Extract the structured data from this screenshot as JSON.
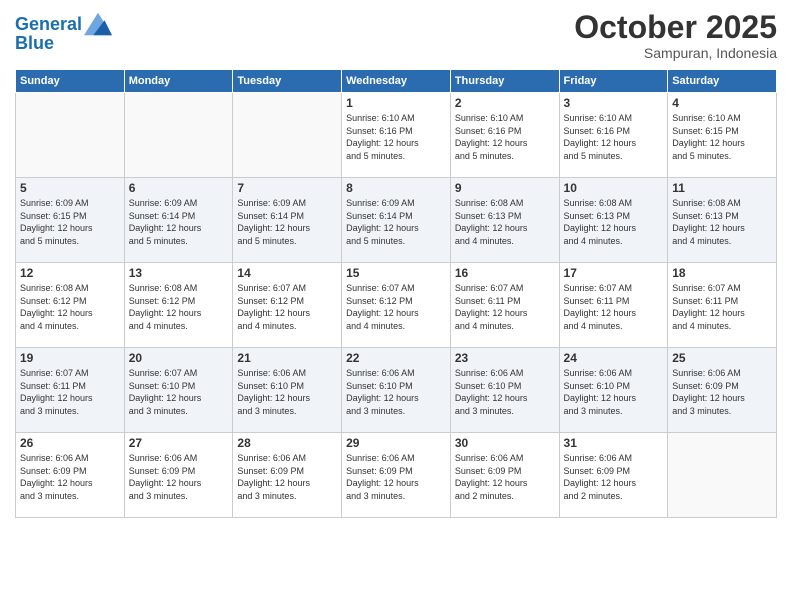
{
  "logo": {
    "line1": "General",
    "line2": "Blue"
  },
  "header": {
    "month": "October 2025",
    "location": "Sampuran, Indonesia"
  },
  "days_of_week": [
    "Sunday",
    "Monday",
    "Tuesday",
    "Wednesday",
    "Thursday",
    "Friday",
    "Saturday"
  ],
  "weeks": [
    [
      {
        "day": "",
        "info": ""
      },
      {
        "day": "",
        "info": ""
      },
      {
        "day": "",
        "info": ""
      },
      {
        "day": "1",
        "info": "Sunrise: 6:10 AM\nSunset: 6:16 PM\nDaylight: 12 hours\nand 5 minutes."
      },
      {
        "day": "2",
        "info": "Sunrise: 6:10 AM\nSunset: 6:16 PM\nDaylight: 12 hours\nand 5 minutes."
      },
      {
        "day": "3",
        "info": "Sunrise: 6:10 AM\nSunset: 6:16 PM\nDaylight: 12 hours\nand 5 minutes."
      },
      {
        "day": "4",
        "info": "Sunrise: 6:10 AM\nSunset: 6:15 PM\nDaylight: 12 hours\nand 5 minutes."
      }
    ],
    [
      {
        "day": "5",
        "info": "Sunrise: 6:09 AM\nSunset: 6:15 PM\nDaylight: 12 hours\nand 5 minutes."
      },
      {
        "day": "6",
        "info": "Sunrise: 6:09 AM\nSunset: 6:14 PM\nDaylight: 12 hours\nand 5 minutes."
      },
      {
        "day": "7",
        "info": "Sunrise: 6:09 AM\nSunset: 6:14 PM\nDaylight: 12 hours\nand 5 minutes."
      },
      {
        "day": "8",
        "info": "Sunrise: 6:09 AM\nSunset: 6:14 PM\nDaylight: 12 hours\nand 5 minutes."
      },
      {
        "day": "9",
        "info": "Sunrise: 6:08 AM\nSunset: 6:13 PM\nDaylight: 12 hours\nand 4 minutes."
      },
      {
        "day": "10",
        "info": "Sunrise: 6:08 AM\nSunset: 6:13 PM\nDaylight: 12 hours\nand 4 minutes."
      },
      {
        "day": "11",
        "info": "Sunrise: 6:08 AM\nSunset: 6:13 PM\nDaylight: 12 hours\nand 4 minutes."
      }
    ],
    [
      {
        "day": "12",
        "info": "Sunrise: 6:08 AM\nSunset: 6:12 PM\nDaylight: 12 hours\nand 4 minutes."
      },
      {
        "day": "13",
        "info": "Sunrise: 6:08 AM\nSunset: 6:12 PM\nDaylight: 12 hours\nand 4 minutes."
      },
      {
        "day": "14",
        "info": "Sunrise: 6:07 AM\nSunset: 6:12 PM\nDaylight: 12 hours\nand 4 minutes."
      },
      {
        "day": "15",
        "info": "Sunrise: 6:07 AM\nSunset: 6:12 PM\nDaylight: 12 hours\nand 4 minutes."
      },
      {
        "day": "16",
        "info": "Sunrise: 6:07 AM\nSunset: 6:11 PM\nDaylight: 12 hours\nand 4 minutes."
      },
      {
        "day": "17",
        "info": "Sunrise: 6:07 AM\nSunset: 6:11 PM\nDaylight: 12 hours\nand 4 minutes."
      },
      {
        "day": "18",
        "info": "Sunrise: 6:07 AM\nSunset: 6:11 PM\nDaylight: 12 hours\nand 4 minutes."
      }
    ],
    [
      {
        "day": "19",
        "info": "Sunrise: 6:07 AM\nSunset: 6:11 PM\nDaylight: 12 hours\nand 3 minutes."
      },
      {
        "day": "20",
        "info": "Sunrise: 6:07 AM\nSunset: 6:10 PM\nDaylight: 12 hours\nand 3 minutes."
      },
      {
        "day": "21",
        "info": "Sunrise: 6:06 AM\nSunset: 6:10 PM\nDaylight: 12 hours\nand 3 minutes."
      },
      {
        "day": "22",
        "info": "Sunrise: 6:06 AM\nSunset: 6:10 PM\nDaylight: 12 hours\nand 3 minutes."
      },
      {
        "day": "23",
        "info": "Sunrise: 6:06 AM\nSunset: 6:10 PM\nDaylight: 12 hours\nand 3 minutes."
      },
      {
        "day": "24",
        "info": "Sunrise: 6:06 AM\nSunset: 6:10 PM\nDaylight: 12 hours\nand 3 minutes."
      },
      {
        "day": "25",
        "info": "Sunrise: 6:06 AM\nSunset: 6:09 PM\nDaylight: 12 hours\nand 3 minutes."
      }
    ],
    [
      {
        "day": "26",
        "info": "Sunrise: 6:06 AM\nSunset: 6:09 PM\nDaylight: 12 hours\nand 3 minutes."
      },
      {
        "day": "27",
        "info": "Sunrise: 6:06 AM\nSunset: 6:09 PM\nDaylight: 12 hours\nand 3 minutes."
      },
      {
        "day": "28",
        "info": "Sunrise: 6:06 AM\nSunset: 6:09 PM\nDaylight: 12 hours\nand 3 minutes."
      },
      {
        "day": "29",
        "info": "Sunrise: 6:06 AM\nSunset: 6:09 PM\nDaylight: 12 hours\nand 3 minutes."
      },
      {
        "day": "30",
        "info": "Sunrise: 6:06 AM\nSunset: 6:09 PM\nDaylight: 12 hours\nand 2 minutes."
      },
      {
        "day": "31",
        "info": "Sunrise: 6:06 AM\nSunset: 6:09 PM\nDaylight: 12 hours\nand 2 minutes."
      },
      {
        "day": "",
        "info": ""
      }
    ]
  ]
}
